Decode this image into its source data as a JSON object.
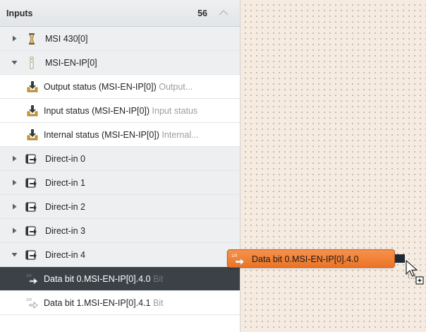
{
  "panel": {
    "title": "Inputs",
    "count": "56"
  },
  "tree": [
    {
      "label": "MSI 430[0]",
      "sub": "",
      "kind": "group",
      "icon": "hourglass-icon",
      "expanded": false
    },
    {
      "label": "MSI-EN-IP[0]",
      "sub": "",
      "kind": "group",
      "icon": "module-icon",
      "expanded": true
    },
    {
      "label": "Output status (MSI-EN-IP[0])",
      "sub": "Output...",
      "kind": "child",
      "icon": "download-tray-icon"
    },
    {
      "label": "Input status (MSI-EN-IP[0])",
      "sub": "Input status",
      "kind": "child",
      "icon": "download-tray-icon"
    },
    {
      "label": "Internal status (MSI-EN-IP[0])",
      "sub": "Internal...",
      "kind": "child",
      "icon": "download-tray-icon"
    },
    {
      "label": "Direct-in 0",
      "sub": "",
      "kind": "group",
      "icon": "input-arrow-icon",
      "expanded": false
    },
    {
      "label": "Direct-in 1",
      "sub": "",
      "kind": "group",
      "icon": "input-arrow-icon",
      "expanded": false
    },
    {
      "label": "Direct-in 2",
      "sub": "",
      "kind": "group",
      "icon": "input-arrow-icon",
      "expanded": false
    },
    {
      "label": "Direct-in 3",
      "sub": "",
      "kind": "group",
      "icon": "input-arrow-icon",
      "expanded": false
    },
    {
      "label": "Direct-in 4",
      "sub": "",
      "kind": "group",
      "icon": "input-arrow-icon",
      "expanded": true
    },
    {
      "label": "Data bit 0.MSI-EN-IP[0].4.0",
      "sub": "Bit",
      "kind": "selected",
      "icon": "data-bit-icon"
    },
    {
      "label": "Data bit 1.MSI-EN-IP[0].4.1",
      "sub": "Bit",
      "kind": "child",
      "icon": "data-bit-icon"
    }
  ],
  "drag_node": {
    "label": "Data bit 0.MSI-EN-IP[0].4.0",
    "icon": "data-bit-icon"
  },
  "colors": {
    "accent": "#ec7425",
    "selected_row": "#3c4147",
    "canvas": "#f6ebe0"
  }
}
